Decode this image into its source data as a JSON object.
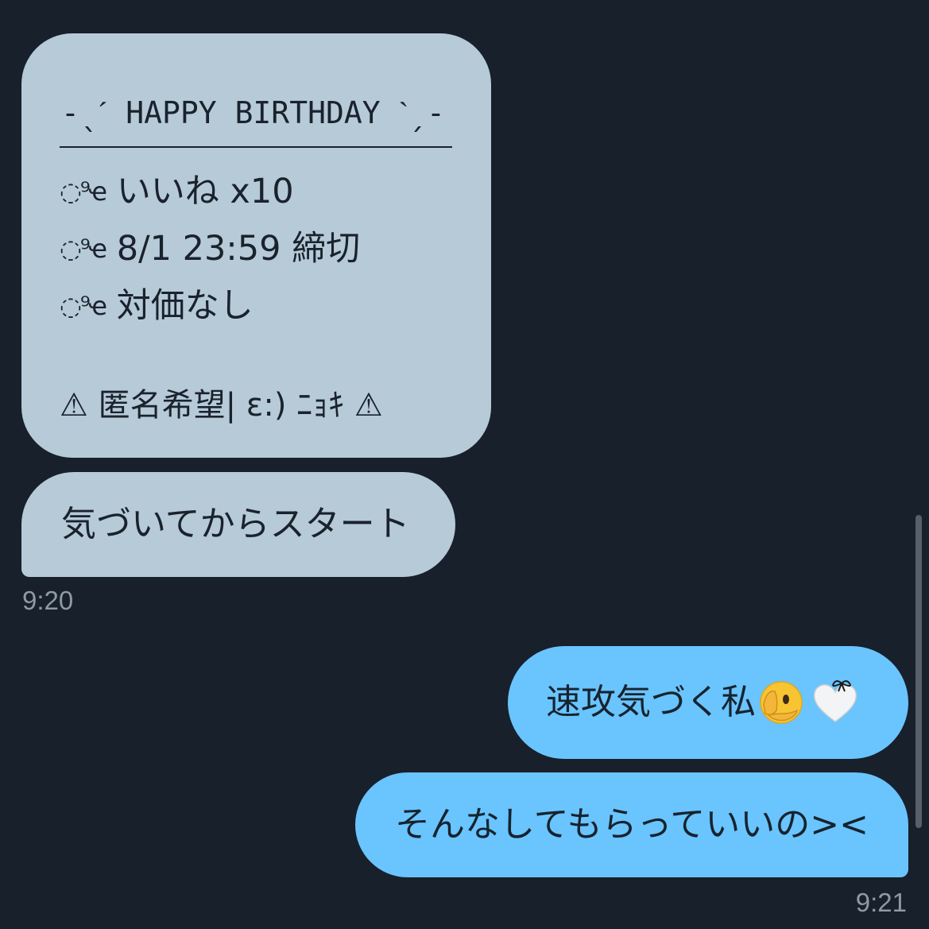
{
  "messages": {
    "received_card": {
      "title": "-ˎˊ HAPPY BIRTHDAY ˋˏ-",
      "rule_1": "ꪆৎ いいね x10",
      "rule_2": "ꪆৎ 8/1 23:59 締切",
      "rule_3": "ꪆৎ 対価なし",
      "note": "⚠ 匿名希望| ε:) ﾆｮｷ ⚠",
      "bullet": "◌⁹ҽ"
    },
    "received_text": "気づいてからスタート",
    "received_time": "9:20",
    "sent_1": "速攻気づく私",
    "sent_1_emojis": [
      "face-with-hand-over-mouth-icon",
      "white-heart-with-ribbon-icon"
    ],
    "sent_2": "そんなしてもらっていいの><",
    "sent_time": "9:21"
  },
  "colors": {
    "background": "#17202b",
    "incoming_bubble": "#b6cad8",
    "outgoing_bubble": "#6ac4fd",
    "timestamp": "#8d9aa6"
  }
}
